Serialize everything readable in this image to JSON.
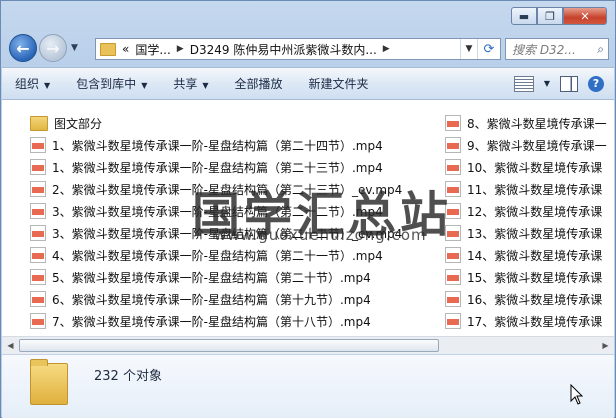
{
  "window": {
    "caption": {
      "minimize": "▬",
      "maximize": "❐",
      "close": "✕"
    }
  },
  "nav": {
    "back_icon": "←",
    "forward_icon": "→",
    "history_dropdown": "▼"
  },
  "address": {
    "prefix": "«",
    "crumbs": [
      "国学...",
      "D3249 陈仲易中州派紫微斗数内..."
    ],
    "dropdown": "▼",
    "refresh_icon": "⟳"
  },
  "search": {
    "placeholder": "搜索 D32...",
    "icon": "🔍"
  },
  "toolbar": {
    "organize": "组织",
    "include_library": "包含到库中",
    "share": "共享",
    "play_all": "全部播放",
    "new_folder": "新建文件夹",
    "dropdown": "▼",
    "help": "?"
  },
  "files": {
    "column1": [
      {
        "name": "图文部分",
        "type": "folder"
      },
      {
        "name": "1、紫微斗数星境传承课一阶-星盘结构篇（第二十四节）.mp4",
        "type": "mp4"
      },
      {
        "name": "1、紫微斗数星境传承课一阶-星盘结构篇（第二十三节）.mp4",
        "type": "mp4"
      },
      {
        "name": "2、紫微斗数星境传承课一阶-星盘结构篇（第二十三节）_ev.mp4",
        "type": "mp4"
      },
      {
        "name": "3、紫微斗数星境传承课一阶-星盘结构篇（第二十二节）.mp4",
        "type": "mp4"
      },
      {
        "name": "3、紫微斗数星境传承课一阶-星盘结构篇（第二十二节）_ev.mp4",
        "type": "mp4"
      },
      {
        "name": "4、紫微斗数星境传承课一阶-星盘结构篇（第二十一节）.mp4",
        "type": "mp4"
      },
      {
        "name": "5、紫微斗数星境传承课一阶-星盘结构篇（第二十节）.mp4",
        "type": "mp4"
      },
      {
        "name": "6、紫微斗数星境传承课一阶-星盘结构篇（第十九节）.mp4",
        "type": "mp4"
      },
      {
        "name": "7、紫微斗数星境传承课一阶-星盘结构篇（第十八节）.mp4",
        "type": "mp4"
      }
    ],
    "column2": [
      {
        "name": "8、紫微斗数星境传承课一",
        "type": "mp4"
      },
      {
        "name": "9、紫微斗数星境传承课一",
        "type": "mp4"
      },
      {
        "name": "10、紫微斗数星境传承课",
        "type": "mp4"
      },
      {
        "name": "11、紫微斗数星境传承课",
        "type": "mp4"
      },
      {
        "name": "12、紫微斗数星境传承课",
        "type": "mp4"
      },
      {
        "name": "13、紫微斗数星境传承课",
        "type": "mp4"
      },
      {
        "name": "14、紫微斗数星境传承课",
        "type": "mp4"
      },
      {
        "name": "15、紫微斗数星境传承课",
        "type": "mp4"
      },
      {
        "name": "16、紫微斗数星境传承课",
        "type": "mp4"
      },
      {
        "name": "17、紫微斗数星境传承课",
        "type": "mp4"
      }
    ]
  },
  "watermark": {
    "text": "国学汇总站",
    "url": "www.guoxuehuizong.com"
  },
  "scrollbar": {
    "left_arrow": "◀",
    "right_arrow": "▶"
  },
  "status": {
    "count": "232 个对象"
  }
}
